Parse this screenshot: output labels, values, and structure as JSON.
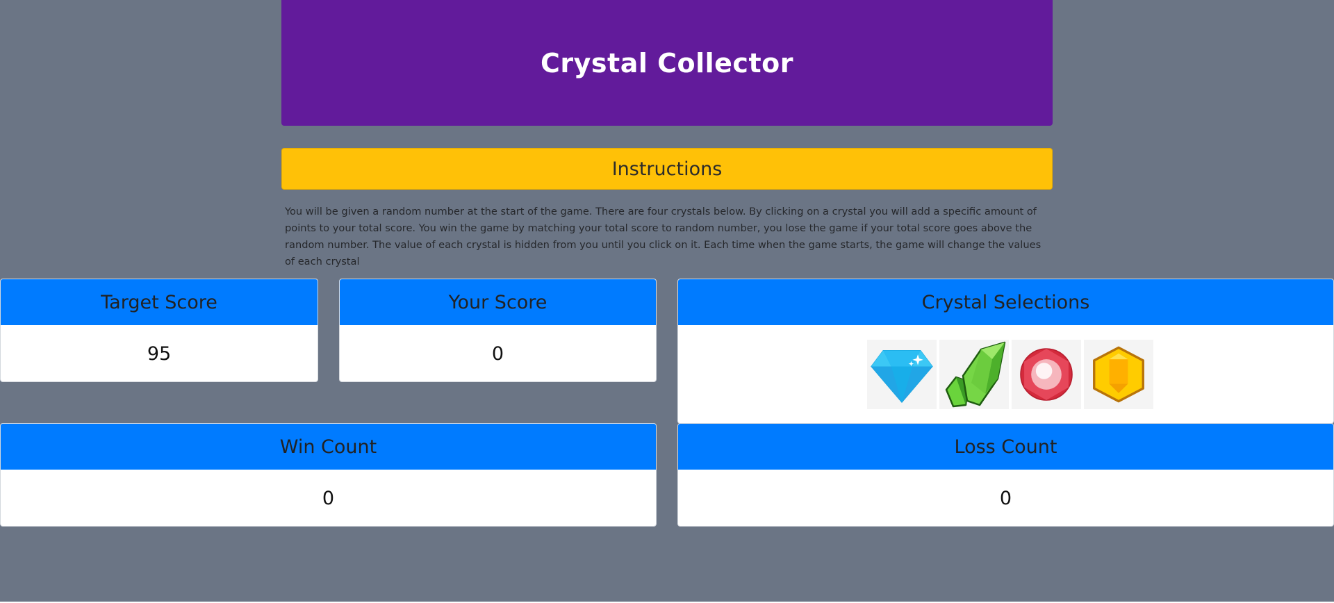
{
  "header": {
    "title": "Crystal Collector"
  },
  "instructions": {
    "heading": "Instructions",
    "text": "You will be given a random number at the start of the game. There are four crystals below. By clicking on a crystal you will add a specific amount of points to your total score. You win the game by matching your total score to random number, you lose the game if your total score goes above the random number. The value of each crystal is hidden from you until you click on it. Each time when the game starts, the game will change the values of each crystal"
  },
  "target_score": {
    "label": "Target Score",
    "value": "95"
  },
  "your_score": {
    "label": "Your Score",
    "value": "0"
  },
  "crystal_selections": {
    "label": "Crystal Selections",
    "crystals": [
      {
        "icon": "blue-diamond-icon",
        "color": "#1fb6f0"
      },
      {
        "icon": "green-crystal-icon",
        "color": "#5cc13a"
      },
      {
        "icon": "red-gem-icon",
        "color": "#e03a4e"
      },
      {
        "icon": "yellow-gem-icon",
        "color": "#ffcc00"
      }
    ]
  },
  "win_count": {
    "label": "Win Count",
    "value": "0"
  },
  "loss_count": {
    "label": "Loss Count",
    "value": "0"
  },
  "colors": {
    "background": "#6b7585",
    "header": "#621b9b",
    "instructions_bar": "#ffc107",
    "card_header": "#007bff"
  }
}
